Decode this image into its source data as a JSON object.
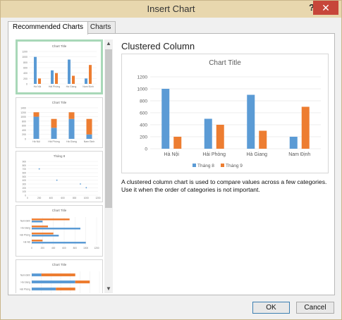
{
  "window": {
    "title": "Insert Chart",
    "help": "?",
    "close": "✕"
  },
  "tabs": {
    "recommended": "Recommended Charts",
    "all": "All Charts"
  },
  "preview": {
    "heading": "Clustered Column",
    "description": "A clustered column chart is used to compare values across a few categories. Use it when the order of categories is not important."
  },
  "thumbnails": [
    {
      "title": "Chart Title",
      "type": "column"
    },
    {
      "title": "Chart Title",
      "type": "stacked-column"
    },
    {
      "title": "Tháng 8",
      "type": "scatter"
    },
    {
      "title": "Chart Title",
      "type": "clustered-bar"
    },
    {
      "title": "Chart Title",
      "type": "stacked-bar"
    }
  ],
  "buttons": {
    "ok": "OK",
    "cancel": "Cancel"
  },
  "colors": {
    "series1": "#5b9bd5",
    "series2": "#ed7d31"
  },
  "chart_data": {
    "type": "bar",
    "title": "Chart Title",
    "categories": [
      "Hà Nội",
      "Hải Phòng",
      "Hà Giang",
      "Nam Định"
    ],
    "series": [
      {
        "name": "Tháng 8",
        "values": [
          1000,
          500,
          900,
          200
        ]
      },
      {
        "name": "Tháng 9",
        "values": [
          200,
          400,
          300,
          700
        ]
      }
    ],
    "yticks": [
      "0",
      "200",
      "400",
      "600",
      "800",
      "1000",
      "1200"
    ],
    "ylim": [
      0,
      1200
    ],
    "legend": "bottom",
    "grid": true
  }
}
